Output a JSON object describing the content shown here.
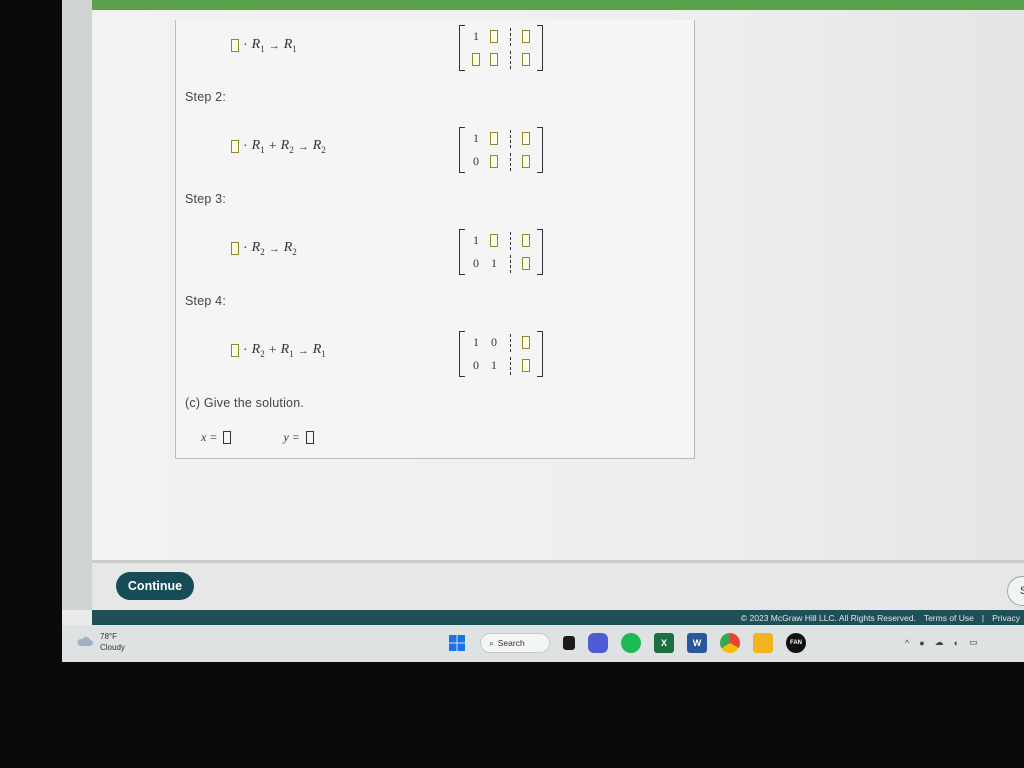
{
  "steps": [
    {
      "label": "",
      "operation": {
        "row_a": "R1",
        "row_b": "",
        "target": "R1"
      },
      "matrix": {
        "r1": [
          "1",
          "",
          "",
          ""
        ],
        "r2": [
          "",
          "",
          "",
          ""
        ]
      }
    },
    {
      "label": "Step 2:",
      "operation": {
        "row_a": "R1",
        "row_b": "R2",
        "target": "R2"
      },
      "matrix": {
        "r1": [
          "1",
          "",
          "",
          ""
        ],
        "r2": [
          "0",
          "",
          "",
          ""
        ]
      }
    },
    {
      "label": "Step 3:",
      "operation": {
        "row_a": "R2",
        "row_b": "",
        "target": "R2"
      },
      "matrix": {
        "r1": [
          "1",
          "",
          "",
          ""
        ],
        "r2": [
          "0",
          "1",
          "",
          ""
        ]
      }
    },
    {
      "label": "Step 4:",
      "operation": {
        "row_a": "R2",
        "row_b": "R1",
        "target": "R1"
      },
      "matrix": {
        "r1": [
          "1",
          "0",
          "",
          ""
        ],
        "r2": [
          "0",
          "1",
          "",
          ""
        ]
      }
    }
  ],
  "part_c": {
    "prompt": "(c) Give the solution.",
    "x_label": "x =",
    "y_label": "y ="
  },
  "continue_label": "Continue",
  "right_button_label": "S",
  "footer": {
    "copyright": "© 2023 McGraw Hill LLC. All Rights Reserved.",
    "terms": "Terms of Use",
    "divider": "|",
    "privacy": "Privacy"
  },
  "taskbar": {
    "weather_temp": "78°F",
    "weather_desc": "Cloudy",
    "search_label": "Search",
    "apps": [
      "windows-icon",
      "search",
      "app-icon",
      "chat-icon",
      "spotify-icon",
      "excel-icon",
      "word-icon",
      "chrome-icon",
      "file-explorer-icon",
      "fanatics-icon"
    ]
  },
  "colors": {
    "continue_bg": "#164c55",
    "footer_bg": "#1f4f57",
    "top_bar": "#5aa14a",
    "highlight_box": "#8a8a2a"
  }
}
